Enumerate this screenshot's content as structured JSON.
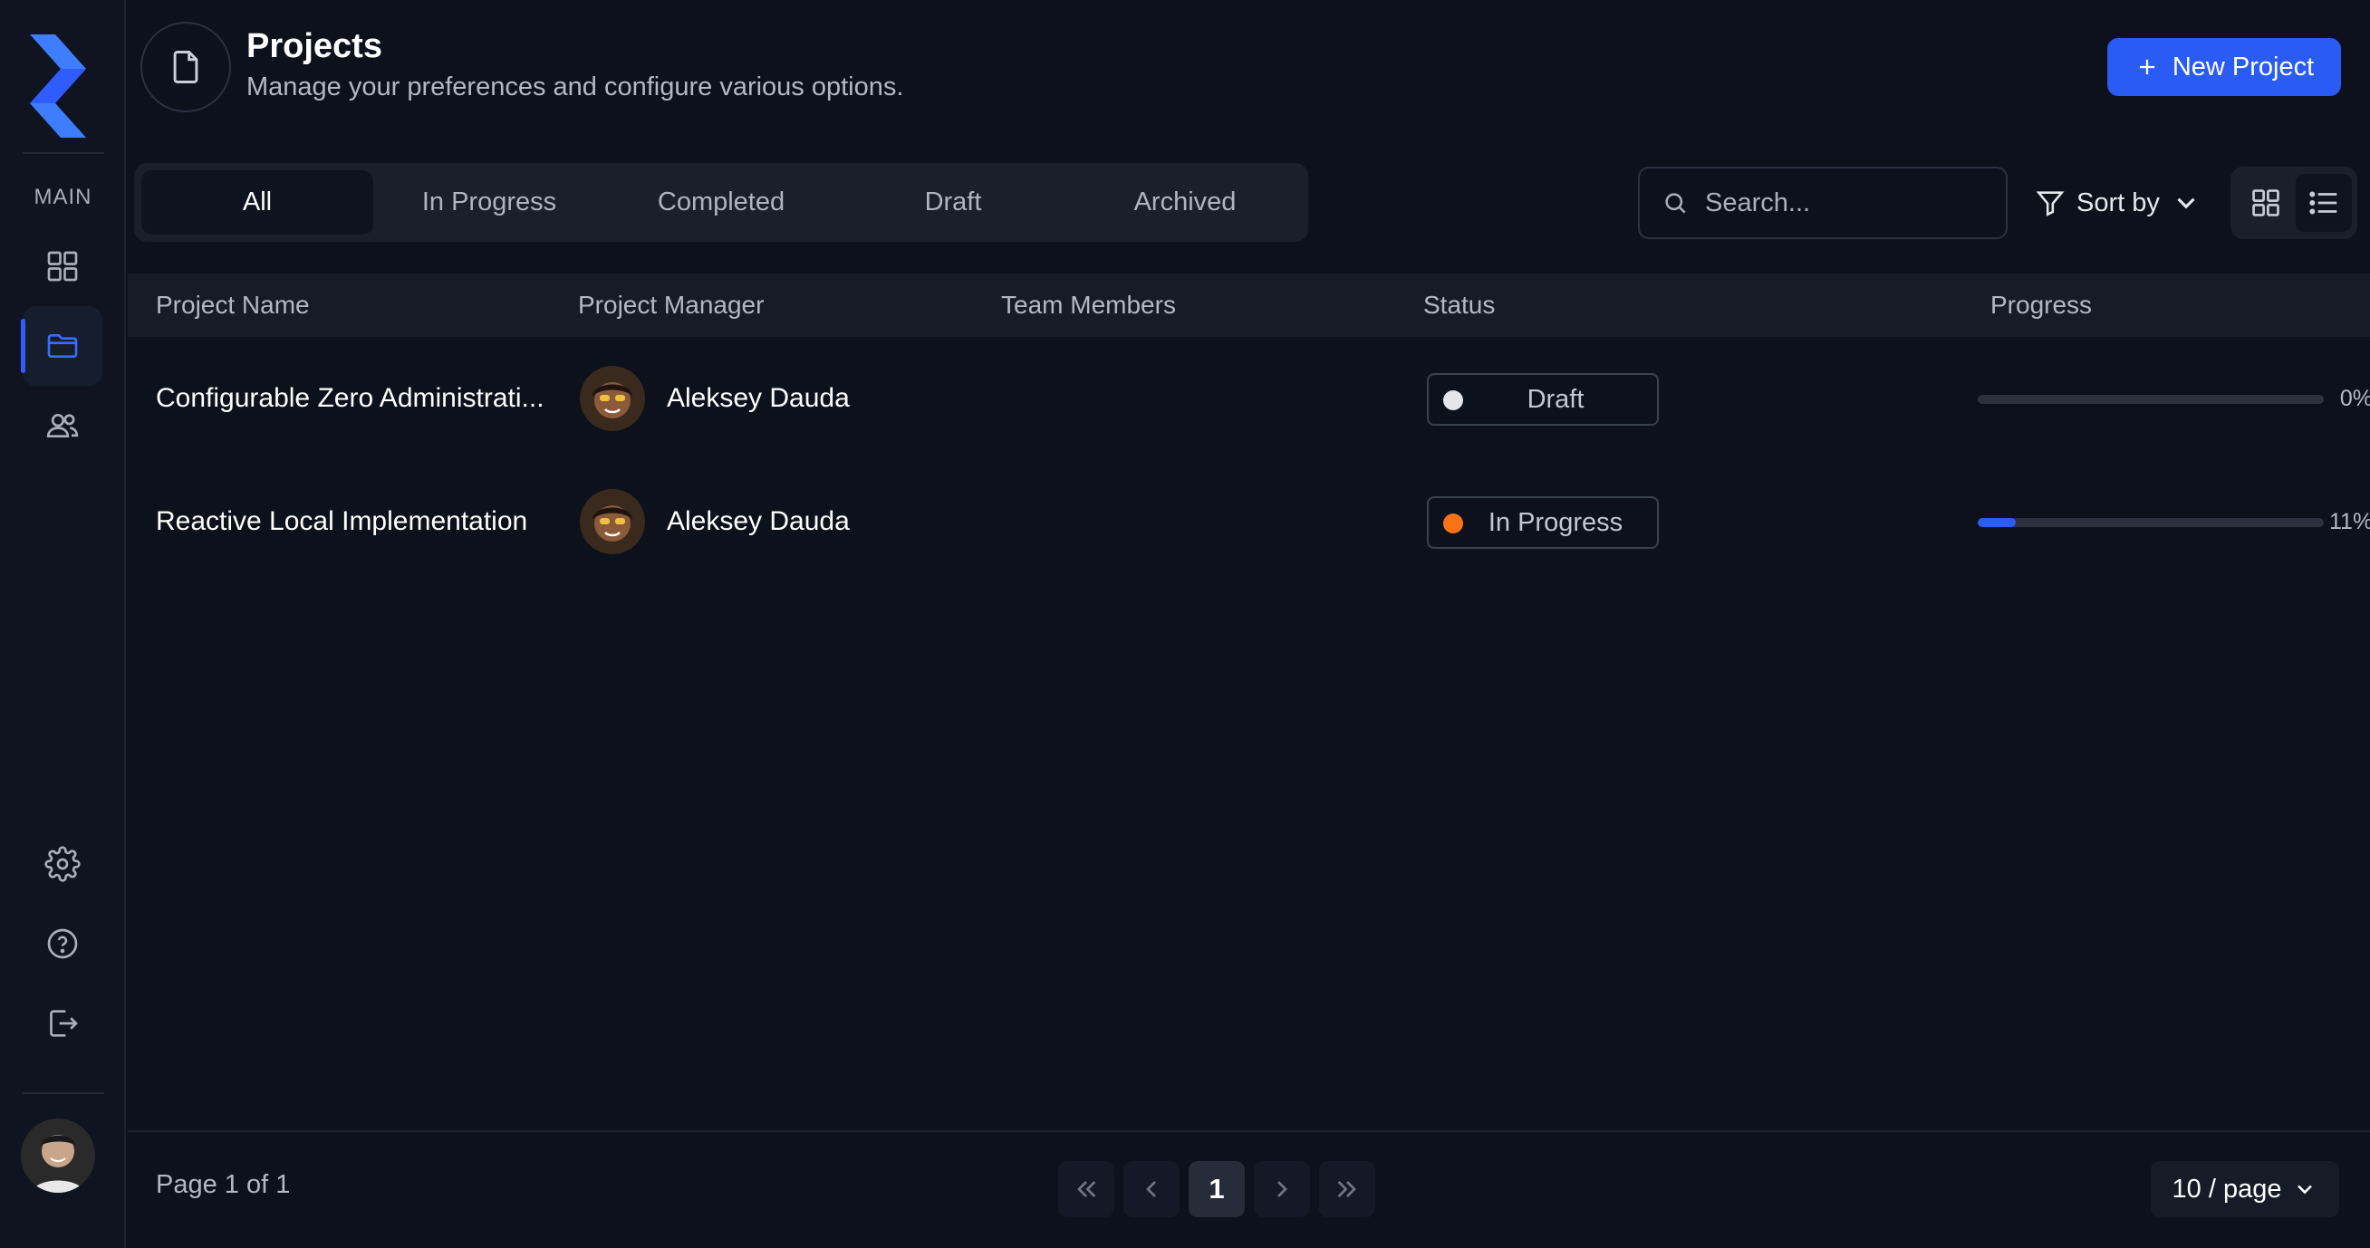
{
  "sidebar": {
    "section_label": "MAIN",
    "items": [
      {
        "name": "dashboard",
        "icon": "grid-icon"
      },
      {
        "name": "projects",
        "icon": "folder-icon",
        "active": true
      },
      {
        "name": "team",
        "icon": "users-icon"
      }
    ],
    "bottom_items": [
      {
        "name": "settings",
        "icon": "gear-icon"
      },
      {
        "name": "help",
        "icon": "help-circle-icon"
      },
      {
        "name": "logout",
        "icon": "logout-icon"
      }
    ]
  },
  "header": {
    "title": "Projects",
    "subtitle": "Manage your preferences and configure various options.",
    "new_button_label": "New Project"
  },
  "tabs": [
    {
      "label": "All",
      "active": true
    },
    {
      "label": "In Progress"
    },
    {
      "label": "Completed"
    },
    {
      "label": "Draft"
    },
    {
      "label": "Archived"
    }
  ],
  "toolbar": {
    "search_placeholder": "Search...",
    "sort_label": "Sort by",
    "view_mode": "list"
  },
  "table": {
    "columns": [
      "Project Name",
      "Project Manager",
      "Team Members",
      "Status",
      "Progress"
    ],
    "rows": [
      {
        "name": "Configurable Zero Administrati...",
        "manager": "Aleksey Dauda",
        "status": "Draft",
        "status_color": "#e4e6eb",
        "progress": 0,
        "progress_label": "0%"
      },
      {
        "name": "Reactive Local Implementation",
        "manager": "Aleksey Dauda",
        "status": "In Progress",
        "status_color": "#f97316",
        "progress": 11,
        "progress_label": "11%"
      }
    ]
  },
  "pagination": {
    "info": "Page 1 of 1",
    "current_page": "1",
    "per_page_label": "10 / page"
  },
  "colors": {
    "accent": "#2b5bf5",
    "background": "#0d111b"
  }
}
